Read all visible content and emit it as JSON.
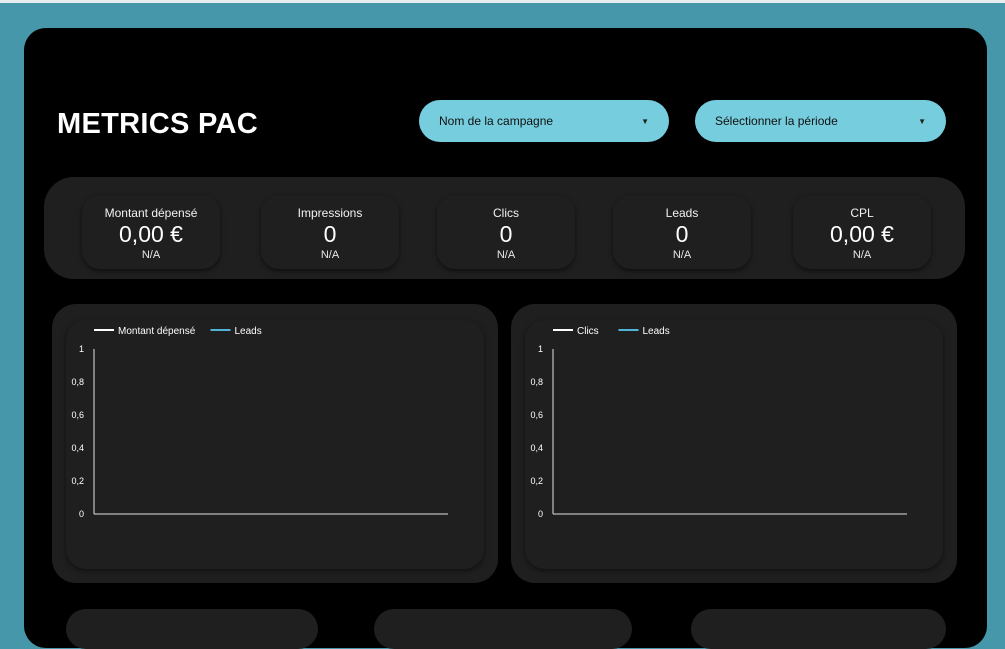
{
  "header": {
    "title": "METRICS PAC",
    "campaign_dropdown": {
      "label": "Nom de la campagne",
      "icon": "caret-down-icon"
    },
    "period_dropdown": {
      "label": "Sélectionner la période",
      "icon": "caret-down-icon"
    }
  },
  "kpis": [
    {
      "label": "Montant dépensé",
      "value": "0,00 €",
      "comparison": "N/A"
    },
    {
      "label": "Impressions",
      "value": "0",
      "comparison": "N/A"
    },
    {
      "label": "Clics",
      "value": "0",
      "comparison": "N/A"
    },
    {
      "label": "Leads",
      "value": "0",
      "comparison": "N/A"
    },
    {
      "label": "CPL",
      "value": "0,00 €",
      "comparison": "N/A"
    }
  ],
  "chart_data": [
    {
      "type": "line",
      "series": [
        {
          "name": "Montant dépensé",
          "color": "#ffffff",
          "values": []
        },
        {
          "name": "Leads",
          "color": "#4fb4d8",
          "values": []
        }
      ],
      "y_ticks": [
        "1",
        "0,8",
        "0,6",
        "0,4",
        "0,2",
        "0"
      ],
      "ylim": [
        0,
        1
      ],
      "legend": "top-left",
      "grid": false
    },
    {
      "type": "line",
      "series": [
        {
          "name": "Clics",
          "color": "#ffffff",
          "values": []
        },
        {
          "name": "Leads",
          "color": "#4fb4d8",
          "values": []
        }
      ],
      "y_ticks": [
        "1",
        "0,8",
        "0,6",
        "0,4",
        "0,2",
        "0"
      ],
      "ylim": [
        0,
        1
      ],
      "legend": "top-left",
      "grid": false
    }
  ],
  "colors": {
    "page_background": "#4697a9",
    "panel": "#000000",
    "card": "#1f1f1f",
    "dropdown": "#76cddd"
  }
}
